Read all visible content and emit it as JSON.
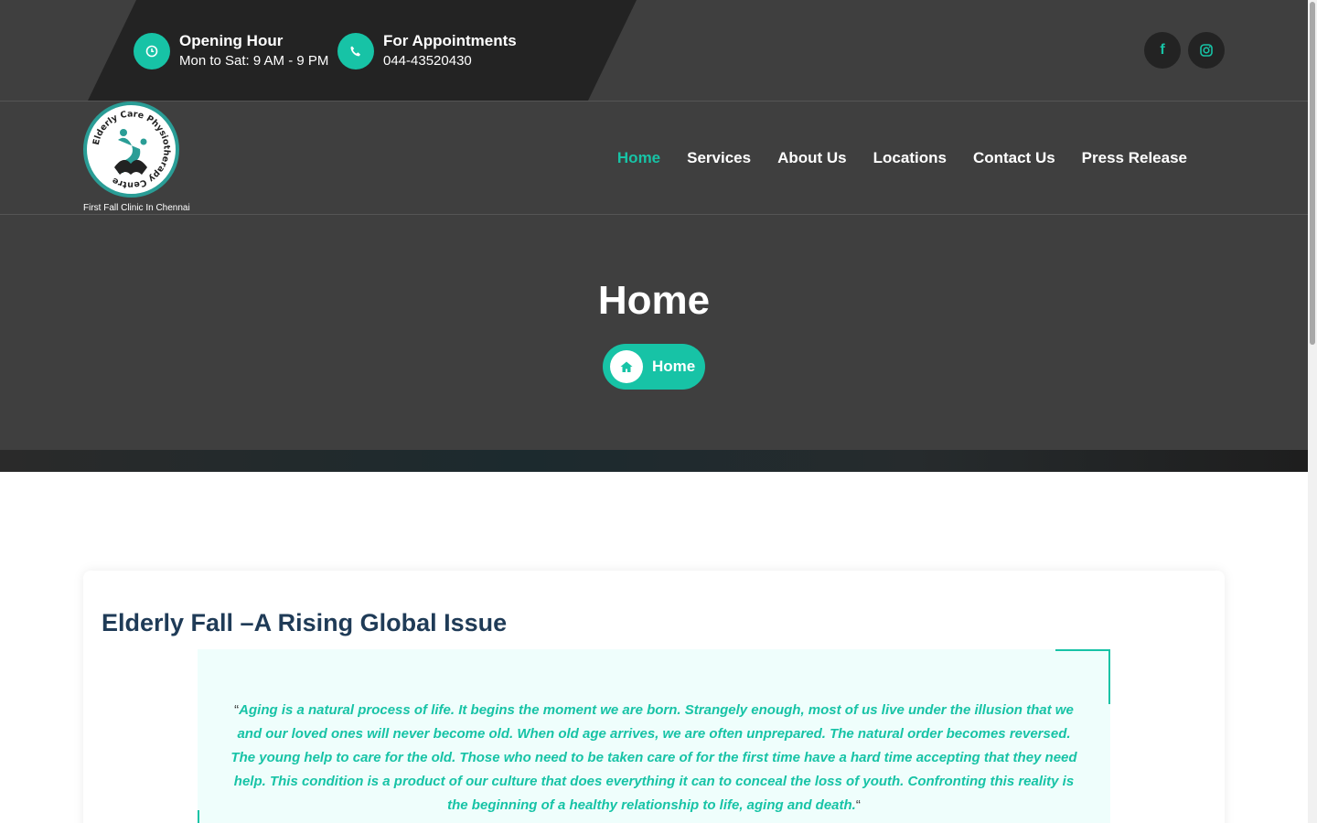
{
  "topbar": {
    "opening": {
      "title": "Opening Hour",
      "value": "Mon to Sat: 9 AM - 9 PM",
      "icon": "clock-icon"
    },
    "appointments": {
      "title": "For Appointments",
      "value": "044-43520430",
      "icon": "phone-icon"
    },
    "social": [
      {
        "name": "facebook-icon",
        "glyph": "f"
      },
      {
        "name": "instagram-icon",
        "glyph": "◎"
      }
    ]
  },
  "header": {
    "logo_text": "Elderly Care Physiotherapy Centre",
    "tagline": "First Fall Clinic In Chennai",
    "nav": [
      "Home",
      "Services",
      "About Us",
      "Locations",
      "Contact Us",
      "Press Release"
    ],
    "active_nav": "Home"
  },
  "hero": {
    "title": "Home",
    "breadcrumb": "Home"
  },
  "article": {
    "title": "Elderly Fall –A Rising Global Issue",
    "open_quote": "“",
    "close_quote": "“",
    "quote": "Aging is a natural process of life. It begins the moment we are born. Strangely enough, most of us live under the illusion that we and our loved ones will never become old. When old age arrives, we are often unprepared. The natural order becomes reversed. The young help to care for the old. Those who need to be taken care of for the first time have a hard time accepting that they need help. This condition is a product of our culture that does everything it can to conceal the loss of youth. Confronting this reality is the beginning of a healthy relationship to life, aging and death."
  },
  "colors": {
    "accent": "#17c3a6",
    "dark": "#3f3f3f",
    "darker": "#232323",
    "heading": "#1f3b57",
    "quote_bg": "#effefc"
  }
}
